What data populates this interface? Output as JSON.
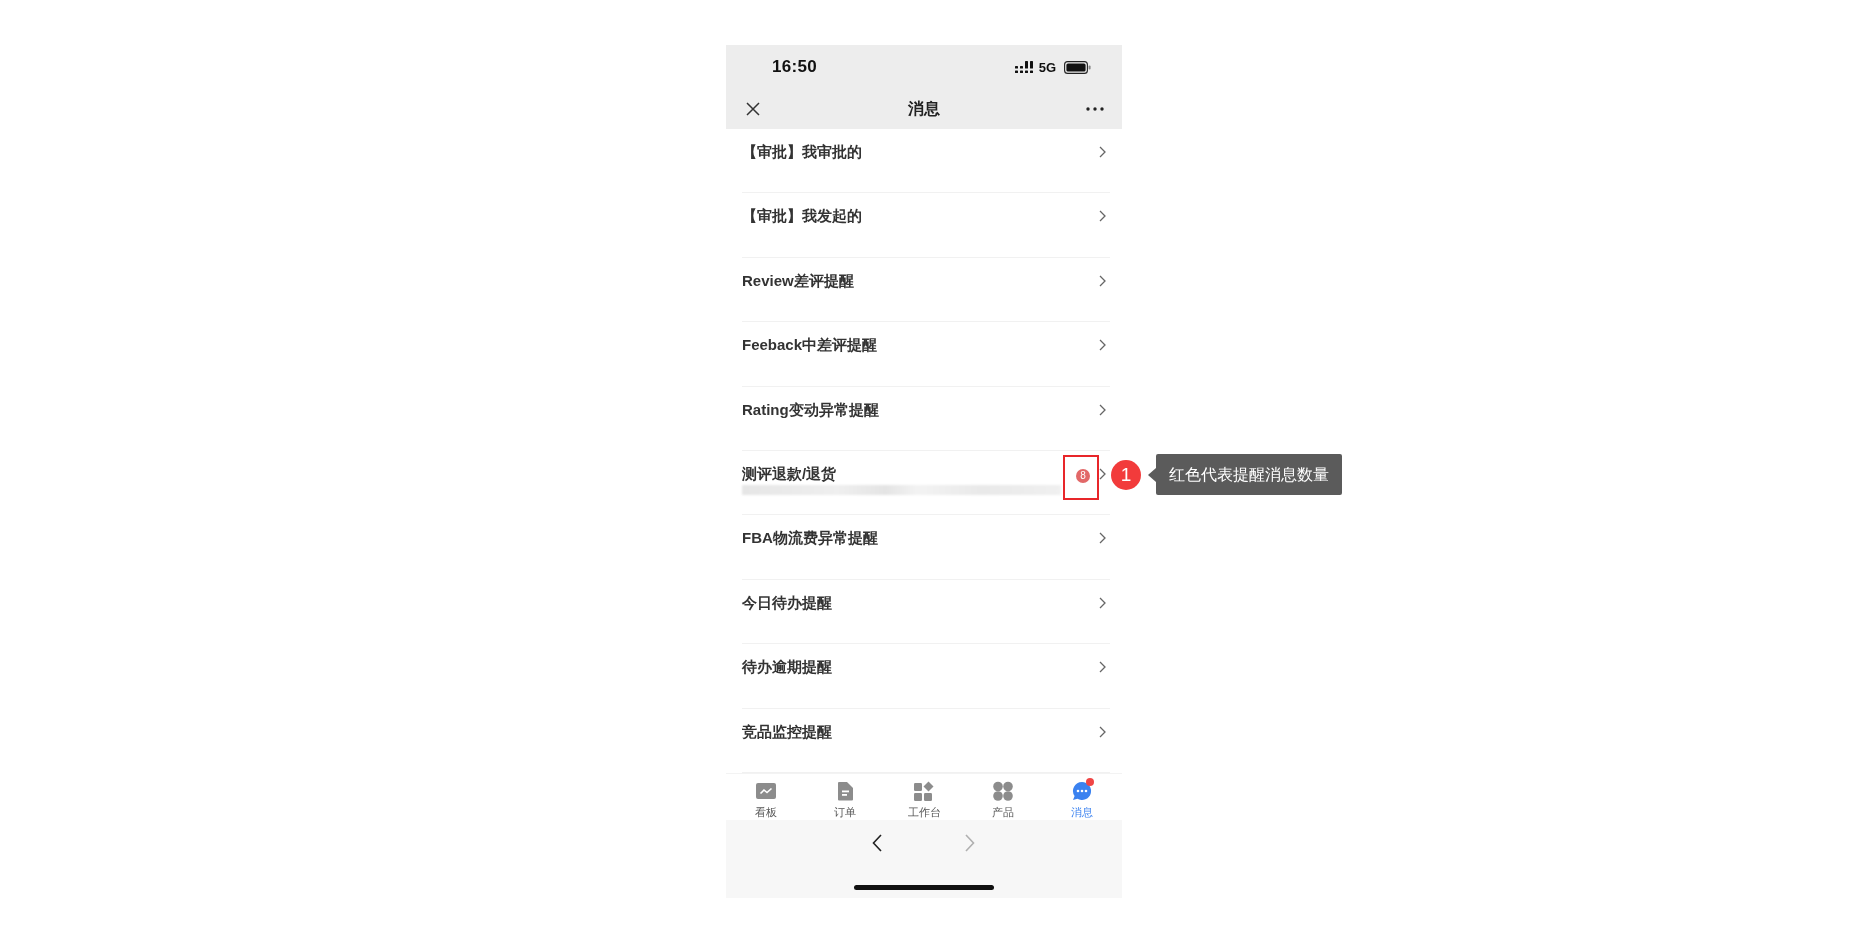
{
  "status_bar": {
    "time": "16:50",
    "network": "5G"
  },
  "header": {
    "title": "消息"
  },
  "messages": [
    {
      "title": "【审批】我审批的",
      "preview_blurred": false,
      "highlighted": false
    },
    {
      "title": "【审批】我发起的",
      "preview_blurred": false,
      "highlighted": false
    },
    {
      "title": "Review差评提醒",
      "preview_blurred": false,
      "highlighted": false
    },
    {
      "title": "Feeback中差评提醒",
      "preview_blurred": false,
      "highlighted": false
    },
    {
      "title": "Rating变动异常提醒",
      "preview_blurred": false,
      "highlighted": false
    },
    {
      "title": "测评退款/退货",
      "preview_blurred": true,
      "badge": "8",
      "highlighted": true,
      "annotation": {
        "number": "1",
        "text": "红色代表提醒消息数量"
      }
    },
    {
      "title": "FBA物流费异常提醒",
      "preview_blurred": false,
      "highlighted": false
    },
    {
      "title": "今日待办提醒",
      "preview_blurred": false,
      "highlighted": false
    },
    {
      "title": "待办逾期提醒",
      "preview_blurred": false,
      "highlighted": false
    },
    {
      "title": "竞品监控提醒",
      "preview_blurred": false,
      "highlighted": false
    }
  ],
  "tabs": [
    {
      "label": "看板",
      "selected": false,
      "dot": false
    },
    {
      "label": "订单",
      "selected": false,
      "dot": false
    },
    {
      "label": "工作台",
      "selected": false,
      "dot": false
    },
    {
      "label": "产品",
      "selected": false,
      "dot": false
    },
    {
      "label": "消息",
      "selected": true,
      "dot": true
    }
  ],
  "browser_toolbar": {
    "back_disabled": false,
    "forward_disabled": true
  }
}
